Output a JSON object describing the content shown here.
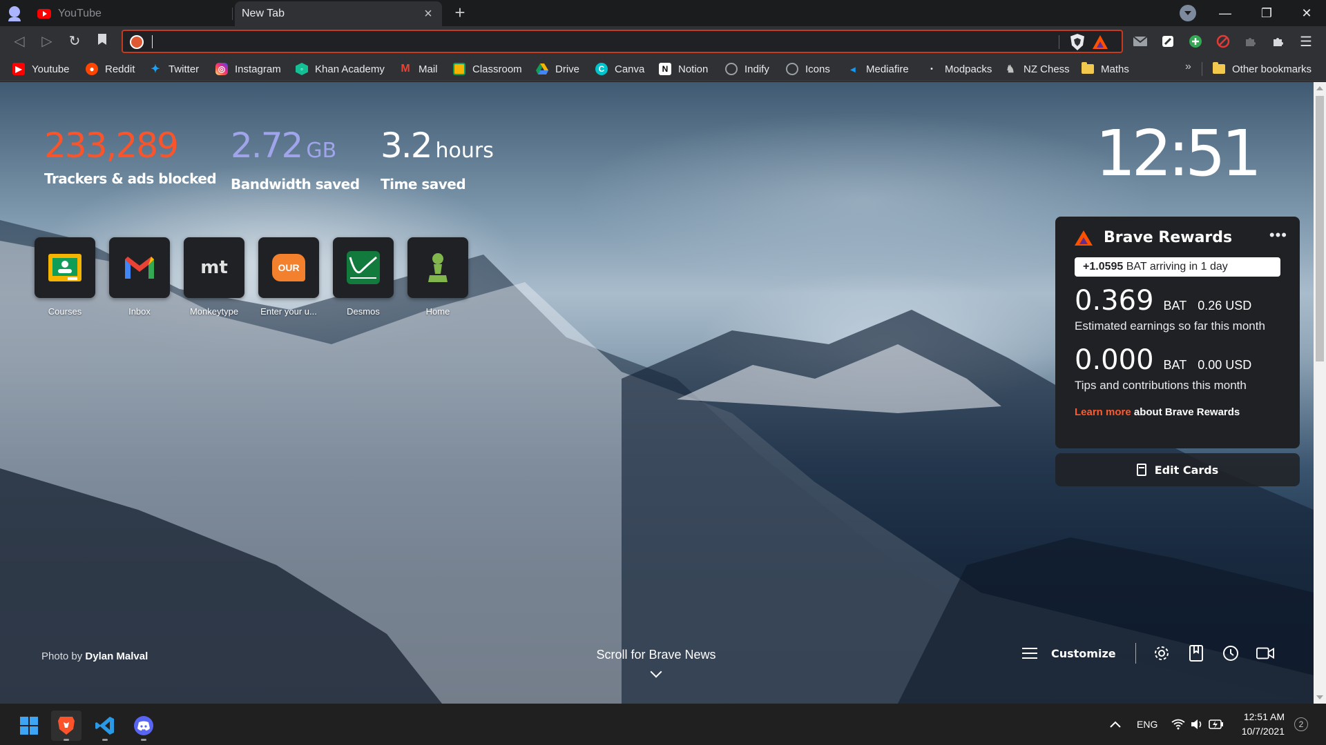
{
  "tabs": [
    {
      "title": "YouTube",
      "active": false
    },
    {
      "title": "New Tab",
      "active": true
    }
  ],
  "window_controls": {
    "minimize": "—",
    "maximize": "❐",
    "close": "✕"
  },
  "address_bar": {
    "value": "",
    "placeholder": ""
  },
  "bookmarks": [
    {
      "label": "Youtube",
      "icon": "youtube-icon",
      "color": "#ff0000"
    },
    {
      "label": "Reddit",
      "icon": "reddit-icon",
      "color": "#ff4500"
    },
    {
      "label": "Twitter",
      "icon": "twitter-icon",
      "color": "#1da1f2"
    },
    {
      "label": "Instagram",
      "icon": "instagram-icon",
      "color": "#d6249f"
    },
    {
      "label": "Khan Academy",
      "icon": "khan-academy-icon",
      "color": "#14bf96"
    },
    {
      "label": "Mail",
      "icon": "gmail-icon",
      "color": "#ea4335"
    },
    {
      "label": "Classroom",
      "icon": "classroom-icon",
      "color": "#f4b400"
    },
    {
      "label": "Drive",
      "icon": "drive-icon",
      "color": "#1fa463"
    },
    {
      "label": "Canva",
      "icon": "canva-icon",
      "color": "#00c4cc"
    },
    {
      "label": "Notion",
      "icon": "notion-icon",
      "color": "#ffffff"
    },
    {
      "label": "Indify",
      "icon": "globe-icon",
      "color": "#9aa0a6"
    },
    {
      "label": "Icons",
      "icon": "globe-icon",
      "color": "#9aa0a6"
    },
    {
      "label": "Mediafire",
      "icon": "mediafire-icon",
      "color": "#1299f3"
    },
    {
      "label": "Modpacks",
      "icon": "modpacks-icon",
      "color": "#e8eaed"
    },
    {
      "label": "NZ Chess",
      "icon": "chess-icon",
      "color": "#c0c0c0"
    },
    {
      "label": "Maths",
      "icon": "folder-icon",
      "color": "#f2c94c"
    }
  ],
  "bookmarks_more": "»",
  "other_bookmarks": "Other bookmarks",
  "stats": {
    "trackers": {
      "value": "233,289",
      "unit": "",
      "label": "Trackers & ads blocked",
      "color": "#fb542b"
    },
    "bandwidth": {
      "value": "2.72",
      "unit": "GB",
      "label": "Bandwidth saved",
      "color": "#a0a5eb"
    },
    "time": {
      "value": "3.2",
      "unit": "hours",
      "label": "Time saved",
      "color": "#ffffff"
    }
  },
  "clock": "12:51",
  "top_sites": [
    {
      "label": "Courses",
      "icon": "classroom-icon"
    },
    {
      "label": "Inbox",
      "icon": "gmail-icon"
    },
    {
      "label": "Monkeytype",
      "icon": "monkeytype-icon",
      "glyph": "mt"
    },
    {
      "label": "Enter your u...",
      "icon": "our-icon",
      "glyph": "OUR"
    },
    {
      "label": "Desmos",
      "icon": "desmos-icon"
    },
    {
      "label": "Home",
      "icon": "chess-pawn-icon"
    }
  ],
  "rewards": {
    "title": "Brave Rewards",
    "more": "•••",
    "arriving_amount": "+1.0595",
    "arriving_text": "BAT arriving in 1 day",
    "earnings": {
      "amount": "0.369",
      "currency": "BAT",
      "usd": "0.26 USD",
      "label": "Estimated earnings so far this month"
    },
    "tips": {
      "amount": "0.000",
      "currency": "BAT",
      "usd": "0.00 USD",
      "label": "Tips and contributions this month"
    },
    "learn_more": "Learn more",
    "learn_more_rest": "about Brave Rewards"
  },
  "edit_cards": "Edit Cards",
  "photo_credit": {
    "prefix": "Photo by",
    "author": "Dylan Malval"
  },
  "scroll_news": "Scroll for Brave News",
  "customize": "Customize",
  "taskbar": {
    "language": "ENG",
    "time": "12:51 AM",
    "date": "10/7/2021",
    "notifications": "2"
  },
  "colors": {
    "accent": "#fb542b",
    "panel": "#1f2124",
    "toolbar": "#303134"
  }
}
